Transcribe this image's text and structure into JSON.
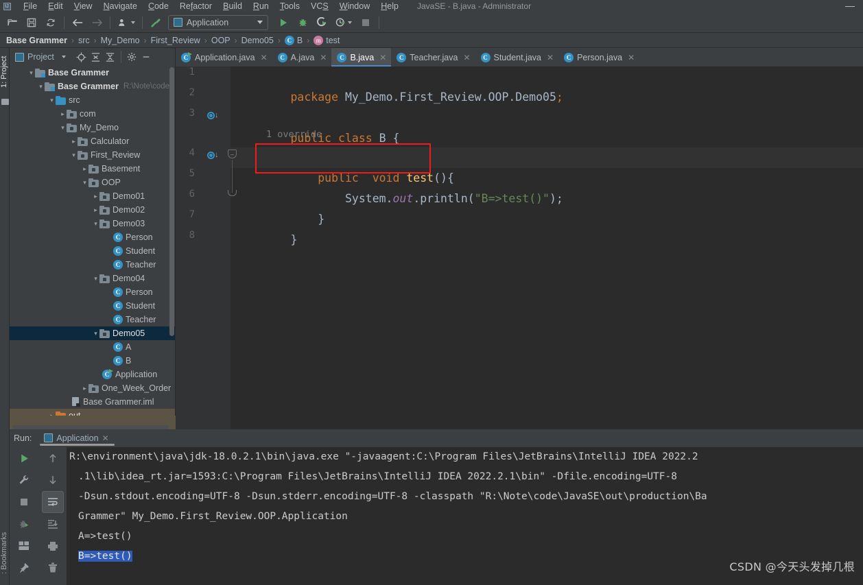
{
  "window": {
    "title": "JavaSE - B.java - Administrator",
    "minimize_label": "—",
    "app_icon": "idea-icon"
  },
  "menubar": {
    "items": [
      {
        "label": "File"
      },
      {
        "label": "Edit"
      },
      {
        "label": "View"
      },
      {
        "label": "Navigate"
      },
      {
        "label": "Code"
      },
      {
        "label": "Refactor"
      },
      {
        "label": "Build"
      },
      {
        "label": "Run"
      },
      {
        "label": "Tools"
      },
      {
        "label": "VCS"
      },
      {
        "label": "Window"
      },
      {
        "label": "Help"
      }
    ]
  },
  "toolbar": {
    "buttons": [
      {
        "name": "open-folder-icon",
        "glyph": ""
      },
      {
        "name": "save-all-icon",
        "glyph": ""
      },
      {
        "name": "sync-refresh-icon",
        "glyph": ""
      },
      {
        "name": "back-arrow-icon",
        "glyph": "←"
      },
      {
        "name": "forward-arrow-icon",
        "glyph": "→"
      },
      {
        "name": "update-project-icon",
        "glyph": ""
      },
      {
        "name": "build-hammer-icon",
        "glyph": ""
      }
    ],
    "run_config": "Application",
    "run_label": "Run",
    "debug_label": "Debug",
    "run_with_coverage_label": "Run with Coverage",
    "profiler_label": "Profiler",
    "stop_label": "Stop"
  },
  "breadcrumb": {
    "items": [
      {
        "label": "Base Grammer",
        "icon": ""
      },
      {
        "label": "src",
        "icon": ""
      },
      {
        "label": "My_Demo",
        "icon": ""
      },
      {
        "label": "First_Review",
        "icon": ""
      },
      {
        "label": "OOP",
        "icon": ""
      },
      {
        "label": "Demo05",
        "icon": ""
      },
      {
        "label": "B",
        "icon": "class-icon",
        "icon_char": "C"
      },
      {
        "label": "test",
        "icon": "method-icon",
        "icon_char": "m"
      }
    ],
    "separator": "›"
  },
  "left_stripe": {
    "project_label": "1: Project",
    "bookmarks_label": ": Bookmarks"
  },
  "project_panel": {
    "title": "Project",
    "toolbar_buttons": [
      {
        "name": "scroll-from-source-icon"
      },
      {
        "name": "expand-all-icon"
      },
      {
        "name": "collapse-all-icon"
      },
      {
        "name": "settings-gear-icon"
      },
      {
        "name": "hide-panel-icon"
      }
    ],
    "tree": [
      {
        "depth": 0,
        "label": "Base Grammer",
        "icon": "module-group-icon",
        "expanded": true,
        "bold": true,
        "path": ""
      },
      {
        "depth": 1,
        "label": "Base Grammer",
        "icon": "module-icon",
        "expanded": true,
        "path": "R:\\Note\\code\\"
      },
      {
        "depth": 2,
        "label": "src",
        "icon": "source-folder-icon",
        "expanded": true,
        "path": ""
      },
      {
        "depth": 3,
        "label": "com",
        "icon": "package-icon",
        "expanded": false,
        "path": ""
      },
      {
        "depth": 3,
        "label": "My_Demo",
        "icon": "package-icon",
        "expanded": true,
        "path": ""
      },
      {
        "depth": 4,
        "label": "Calculator",
        "icon": "package-icon",
        "expanded": false,
        "path": ""
      },
      {
        "depth": 4,
        "label": "First_Review",
        "icon": "package-icon",
        "expanded": true,
        "path": ""
      },
      {
        "depth": 5,
        "label": "Basement",
        "icon": "package-icon",
        "expanded": false,
        "path": ""
      },
      {
        "depth": 5,
        "label": "OOP",
        "icon": "package-icon",
        "expanded": true,
        "path": ""
      },
      {
        "depth": 6,
        "label": "Demo01",
        "icon": "package-icon",
        "expanded": false,
        "path": ""
      },
      {
        "depth": 6,
        "label": "Demo02",
        "icon": "package-icon",
        "expanded": false,
        "path": ""
      },
      {
        "depth": 6,
        "label": "Demo03",
        "icon": "package-icon",
        "expanded": true,
        "path": ""
      },
      {
        "depth": 7,
        "label": "Person",
        "icon": "class-icon",
        "leaf": true,
        "path": ""
      },
      {
        "depth": 7,
        "label": "Student",
        "icon": "class-icon",
        "leaf": true,
        "path": ""
      },
      {
        "depth": 7,
        "label": "Teacher",
        "icon": "class-icon",
        "leaf": true,
        "path": ""
      },
      {
        "depth": 6,
        "label": "Demo04",
        "icon": "package-icon",
        "expanded": true,
        "path": ""
      },
      {
        "depth": 7,
        "label": "Person",
        "icon": "class-icon",
        "leaf": true,
        "path": ""
      },
      {
        "depth": 7,
        "label": "Student",
        "icon": "class-icon",
        "leaf": true,
        "path": ""
      },
      {
        "depth": 7,
        "label": "Teacher",
        "icon": "class-icon",
        "leaf": true,
        "path": ""
      },
      {
        "depth": 6,
        "label": "Demo05",
        "icon": "package-icon",
        "expanded": true,
        "selected": true,
        "path": ""
      },
      {
        "depth": 7,
        "label": "A",
        "icon": "class-icon",
        "leaf": true,
        "path": ""
      },
      {
        "depth": 7,
        "label": "B",
        "icon": "class-icon",
        "leaf": true,
        "path": ""
      },
      {
        "depth": 6,
        "label": "Application",
        "icon": "runnable-class-icon",
        "leaf": true,
        "path": ""
      },
      {
        "depth": 5,
        "label": "One_Week_Order",
        "icon": "package-icon",
        "expanded": false,
        "path": ""
      },
      {
        "depth": 4,
        "label": "Base Grammer.iml",
        "icon": "iml-file-icon",
        "leaf": true,
        "path": ""
      },
      {
        "depth": 2,
        "label": "out",
        "icon": "output-folder-icon",
        "expanded": false,
        "path": ""
      }
    ]
  },
  "editor_tabs": [
    {
      "label": "Application.java",
      "icon": "runnable-class-icon",
      "active": false
    },
    {
      "label": "A.java",
      "icon": "class-icon",
      "active": false
    },
    {
      "label": "B.java",
      "icon": "class-icon",
      "active": true
    },
    {
      "label": "Teacher.java",
      "icon": "class-icon",
      "active": false
    },
    {
      "label": "Student.java",
      "icon": "class-icon",
      "active": false
    },
    {
      "label": "Person.java",
      "icon": "class-icon",
      "active": false
    }
  ],
  "editor": {
    "line_numbers": [
      "1",
      "2",
      "3",
      "4",
      "5",
      "6",
      "7",
      "8"
    ],
    "inlay_hint": "1 override",
    "gutter_icons": [
      {
        "line": 3,
        "name": "overridden-method-icon"
      },
      {
        "line": 4,
        "name": "overriding-method-icon"
      }
    ],
    "code_lines": [
      {
        "n": 1,
        "tokens": [
          {
            "t": "package",
            "c": "kw"
          },
          {
            "t": " My_Demo.First_Review.OOP.Demo05",
            "c": "plain"
          },
          {
            "t": ";",
            "c": "kw"
          }
        ]
      },
      {
        "n": 2,
        "tokens": []
      },
      {
        "n": 3,
        "tokens": [
          {
            "t": "public class ",
            "c": "kw"
          },
          {
            "t": "B ",
            "c": "plain"
          },
          {
            "t": "{",
            "c": "plain"
          }
        ]
      },
      {
        "n": 4,
        "tokens": [
          {
            "t": "    public  void ",
            "c": "kw"
          },
          {
            "t": "test",
            "c": "mth"
          },
          {
            "t": "(){",
            "c": "plain"
          }
        ]
      },
      {
        "n": 5,
        "tokens": [
          {
            "t": "        System.",
            "c": "plain"
          },
          {
            "t": "out",
            "c": "fld"
          },
          {
            "t": ".println(",
            "c": "plain"
          },
          {
            "t": "\"B=>test()\"",
            "c": "str"
          },
          {
            "t": ");",
            "c": "plain"
          }
        ]
      },
      {
        "n": 6,
        "tokens": [
          {
            "t": "    }",
            "c": "plain"
          }
        ]
      },
      {
        "n": 7,
        "tokens": [
          {
            "t": "}",
            "c": "plain"
          }
        ]
      },
      {
        "n": 8,
        "tokens": []
      }
    ],
    "annotation_box": {
      "name": "red-highlight-box",
      "color": "#ee1c1c",
      "target_line": 4
    }
  },
  "run_panel": {
    "label": "Run:",
    "tab": "Application",
    "left_buttons": [
      {
        "name": "rerun-icon"
      },
      {
        "name": "edit-configuration-wrench-icon"
      },
      {
        "name": "stop-icon"
      },
      {
        "name": "debug-rerun-icon"
      },
      {
        "name": "layout-icon"
      },
      {
        "name": "pin-tab-icon"
      }
    ],
    "side_buttons": [
      {
        "name": "up-arrow-icon"
      },
      {
        "name": "down-arrow-icon"
      },
      {
        "name": "soft-wrap-icon",
        "pressed": true
      },
      {
        "name": "scroll-to-end-icon"
      },
      {
        "name": "print-icon"
      },
      {
        "name": "clear-all-trash-icon"
      }
    ],
    "console_lines": [
      {
        "text": "R:\\environment\\java\\jdk-18.0.2.1\\bin\\java.exe \"-javaagent:C:\\Program Files\\JetBrains\\IntelliJ IDEA 2022.2",
        "indent": false
      },
      {
        "text": ".1\\lib\\idea_rt.jar=1593:C:\\Program Files\\JetBrains\\IntelliJ IDEA 2022.2.1\\bin\" -Dfile.encoding=UTF-8",
        "indent": true
      },
      {
        "text": "-Dsun.stdout.encoding=UTF-8 -Dsun.stderr.encoding=UTF-8 -classpath \"R:\\Note\\code\\JavaSE\\out\\production\\Ba",
        "indent": true
      },
      {
        "text": "Grammer\" My_Demo.First_Review.OOP.Application",
        "indent": true
      },
      {
        "text": "A=>test()",
        "indent": true
      },
      {
        "text": "B=>test()",
        "indent": true,
        "selected": true
      }
    ]
  },
  "watermark": {
    "text": "CSDN @今天头发掉几根"
  },
  "colors": {
    "accent_blue": "#3592c4",
    "tab_underline": "#4a88c7",
    "selection_blue": "#2f5bb8",
    "tree_selection": "#0d293e",
    "annotation_red": "#ee1c1c",
    "keyword_orange": "#cc7832",
    "string_green": "#6a8759",
    "method_yellow": "#ffc66d",
    "field_purple": "#9876aa",
    "editor_bg": "#2b2b2b",
    "panel_bg": "#3c3f41"
  }
}
